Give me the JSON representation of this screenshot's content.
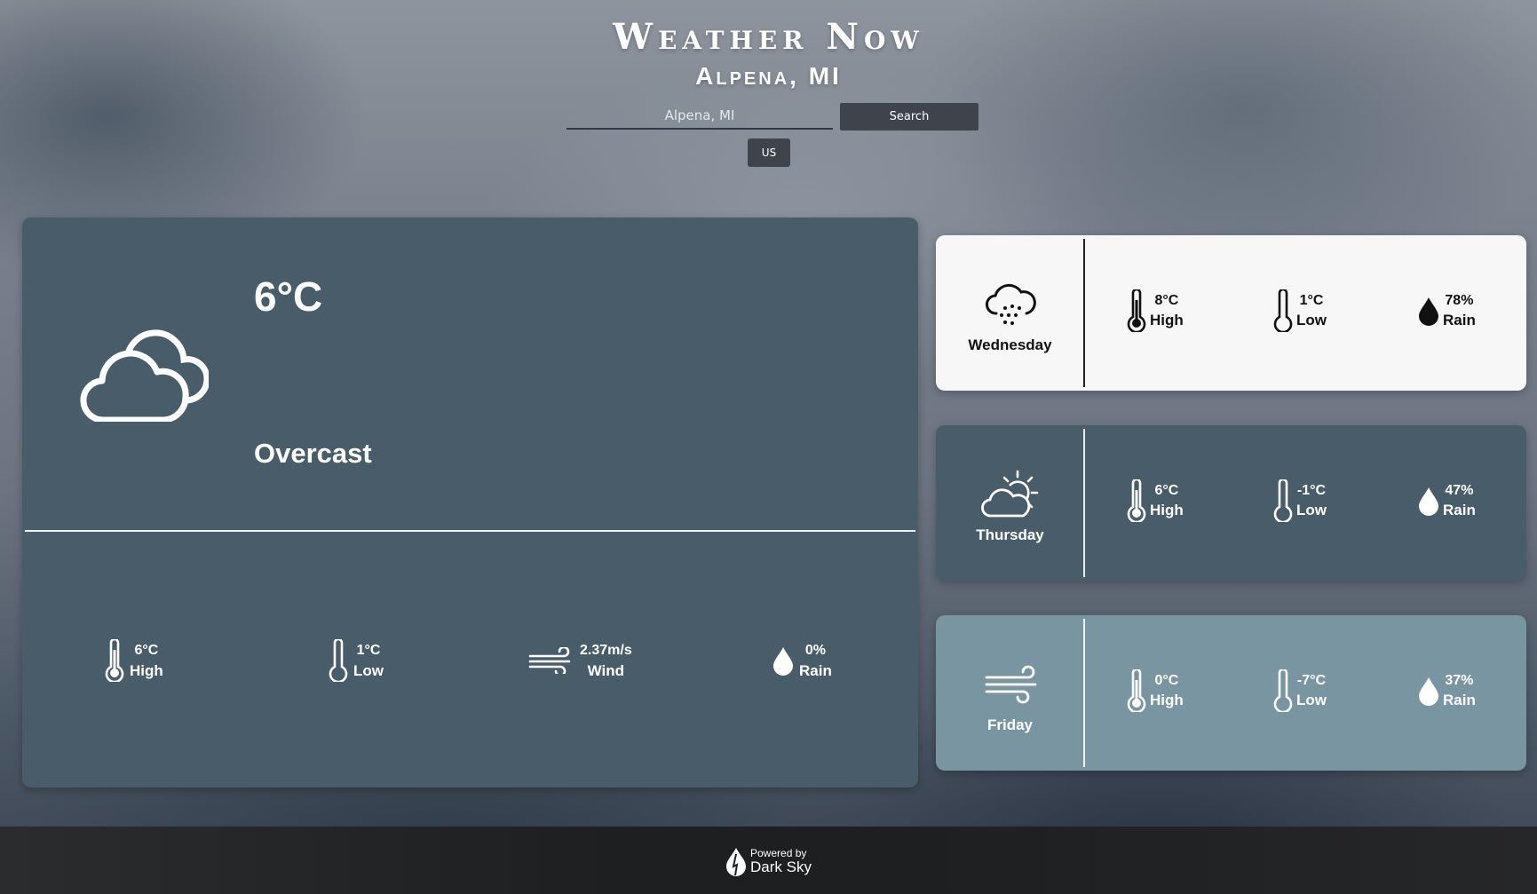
{
  "header": {
    "app_title": "Weather Now",
    "city": "Alpena, MI",
    "search_placeholder": "Alpena, MI",
    "search_label": "Search",
    "units_label": "US"
  },
  "current": {
    "temperature": "6°C",
    "summary": "Overcast",
    "icon": "cloudy-icon",
    "stats": {
      "high": {
        "value": "6°C",
        "label": "High",
        "icon": "thermometer-full-icon"
      },
      "low": {
        "value": "1°C",
        "label": "Low",
        "icon": "thermometer-empty-icon"
      },
      "wind": {
        "value": "2.37m/s",
        "label": "Wind",
        "icon": "wind-icon"
      },
      "rain": {
        "value": "0%",
        "label": "Rain",
        "icon": "raindrop-icon"
      }
    }
  },
  "forecast": [
    {
      "day": "Wednesday",
      "icon": "snow-cloud-icon",
      "high": "8°C",
      "high_label": "High",
      "low": "1°C",
      "low_label": "Low",
      "rain": "78%",
      "rain_label": "Rain",
      "background": "#f7f7f7",
      "text_color": "#111111"
    },
    {
      "day": "Thursday",
      "icon": "partly-cloudy-day-icon",
      "high": "6°C",
      "high_label": "High",
      "low": "-1°C",
      "low_label": "Low",
      "rain": "47%",
      "rain_label": "Rain",
      "background": "#485c69",
      "text_color": "#ffffff"
    },
    {
      "day": "Friday",
      "icon": "wind-icon",
      "high": "0°C",
      "high_label": "High",
      "low": "-7°C",
      "low_label": "Low",
      "rain": "37%",
      "rain_label": "Rain",
      "background": "#7a95a2",
      "text_color": "#ffffff"
    }
  ],
  "footer": {
    "powered_by": "Powered by",
    "brand": "Dark Sky"
  },
  "colors": {
    "current_card": "#485c69",
    "button": "#3f444b",
    "footer": "#1e1f21"
  }
}
